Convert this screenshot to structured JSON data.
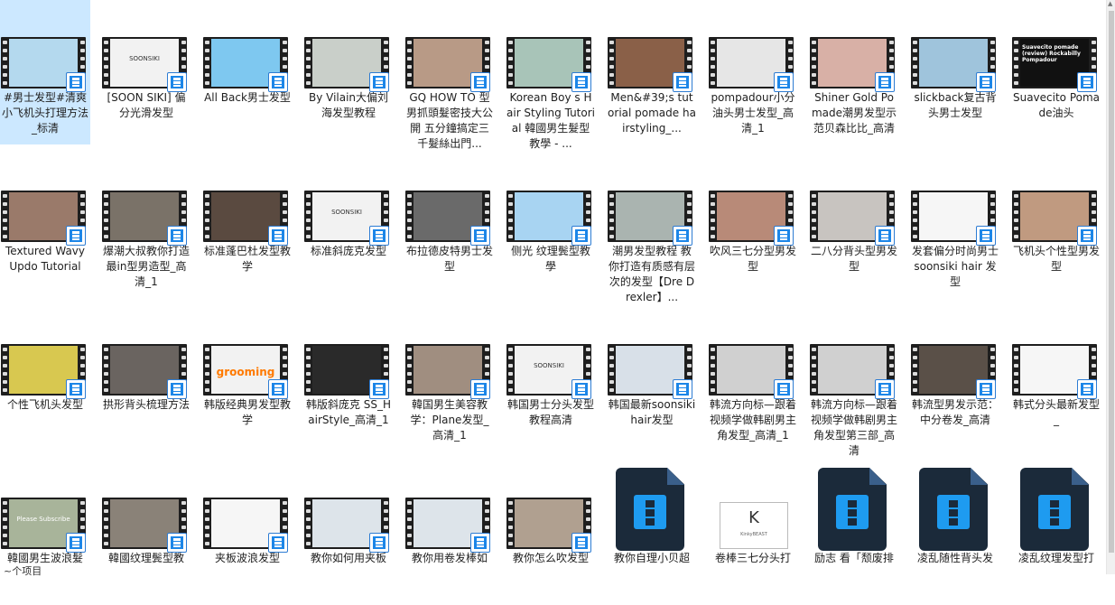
{
  "status_text": "~个项目",
  "files": [
    {
      "label": "#男士发型#清爽小飞机头打理方法_标清",
      "thumb": "#b4d9ee",
      "selected": true,
      "mark": "",
      "markType": "text"
    },
    {
      "label": "[SOON SIKI] 偏分光滑发型",
      "thumb": "#f2f2f2",
      "mark": "SOONSIKI",
      "markType": "text"
    },
    {
      "label": "All Back男士发型",
      "thumb": "#7ec8f0",
      "mark": "",
      "markType": "text"
    },
    {
      "label": "By Vilain大偏刘海发型教程",
      "thumb": "#c9cfc9",
      "mark": "",
      "markType": "text"
    },
    {
      "label": "GQ HOW TO 型男抓頭髮密技大公開 五分鐘搞定三千髮絲出門...",
      "thumb": "#b89a86",
      "mark": "",
      "markType": "text"
    },
    {
      "label": "Korean Boy s Hair Styling Tutorial 韓國男生髮型教學 - ...",
      "thumb": "#a8c4b8",
      "mark": "",
      "markType": "text"
    },
    {
      "label": "Men&#39;s tutorial pomade hairstyling_...",
      "thumb": "#8a6048",
      "mark": "",
      "markType": "text"
    },
    {
      "label": "pompadour小分油头男士发型_高清_1",
      "thumb": "#e6e6e6",
      "mark": "",
      "markType": "text"
    },
    {
      "label": "Shiner Gold Pomade潮男发型示范贝森比比_高清",
      "thumb": "#d8b0a6",
      "mark": "",
      "markType": "text"
    },
    {
      "label": "slickback复古背头男士发型",
      "thumb": "#9fc4dc",
      "mark": "",
      "markType": "text"
    },
    {
      "label": "Suavecito Pomade油头",
      "thumb": "#111111",
      "mark": "Suavecito pomade (review) Rockabilly Pompadour",
      "markType": "dark"
    },
    {
      "label": "Textured Wavy Updo Tutorial",
      "thumb": "#9a7a6a",
      "mark": "",
      "markType": "text"
    },
    {
      "label": "爆潮大叔教你打造最in型男造型_高清_1",
      "thumb": "#7a7268",
      "mark": "",
      "markType": "text"
    },
    {
      "label": "标准蓬巴杜发型教学",
      "thumb": "#5a4a40",
      "mark": "",
      "markType": "text"
    },
    {
      "label": "标准斜庞克发型",
      "thumb": "#f2f2f2",
      "mark": "SOONSIKI",
      "markType": "text"
    },
    {
      "label": "布拉德皮特男士发型",
      "thumb": "#6a6a6a",
      "mark": "",
      "markType": "text"
    },
    {
      "label": "侧光 纹理鬓型教學",
      "thumb": "#a8d4f2",
      "mark": "",
      "markType": "text"
    },
    {
      "label": "潮男发型教程 教你打造有质感有层次的发型【Dre Drexler】...",
      "thumb": "#aab4b0",
      "mark": "",
      "markType": "text"
    },
    {
      "label": "吹风三七分型男发型",
      "thumb": "#b88a78",
      "mark": "",
      "markType": "text"
    },
    {
      "label": "二八分背头型男发型",
      "thumb": "#c8c4c0",
      "mark": "",
      "markType": "text"
    },
    {
      "label": "发套偏分时尚男士 soonsiki hair 发型",
      "thumb": "#f6f6f6",
      "mark": "",
      "markType": "text"
    },
    {
      "label": "飞机头个性型男发型",
      "thumb": "#c09a80",
      "mark": "",
      "markType": "text"
    },
    {
      "label": "个性飞机头发型",
      "thumb": "#d8c850",
      "mark": "",
      "markType": "text"
    },
    {
      "label": "拱形背头梳理方法",
      "thumb": "#6a6460",
      "mark": "",
      "markType": "text"
    },
    {
      "label": "韩版经典男发型教学",
      "thumb": "#f2f2f2",
      "mark": "grooming",
      "markType": "brand"
    },
    {
      "label": "韩版斜庞克 SS_HairStyle_高清_1",
      "thumb": "#2a2a2a",
      "mark": "",
      "markType": "text"
    },
    {
      "label": "韓国男生美容教学：Plane发型_高清_1",
      "thumb": "#a08e80",
      "mark": "",
      "markType": "text"
    },
    {
      "label": "韩国男士分头发型教程高清",
      "thumb": "#f2f2f2",
      "mark": "SOONSIKI",
      "markType": "text"
    },
    {
      "label": "韩国最新soonsiki hair发型",
      "thumb": "#d8e0e8",
      "mark": "",
      "markType": "text"
    },
    {
      "label": "韩流方向标—跟着视频学做韩剧男主角发型_高清_1",
      "thumb": "#d0d0d0",
      "mark": "",
      "markType": "text"
    },
    {
      "label": "韩流方向标—跟着视频学做韩剧男主角发型第三部_高清",
      "thumb": "#d0d0d0",
      "mark": "",
      "markType": "text"
    },
    {
      "label": "韩流型男发示范：中分卷发_高清",
      "thumb": "#5a5048",
      "mark": "",
      "markType": "text"
    },
    {
      "label": "韩式分头最新发型_",
      "thumb": "#f6f6f6",
      "mark": "",
      "markType": "text"
    },
    {
      "label": "韓國男生波浪髮",
      "thumb": "#a8b49a",
      "mark": "Please Subscribe",
      "markType": "light"
    },
    {
      "label": "韓國纹理鬓型教",
      "thumb": "#8a8278",
      "mark": "",
      "markType": "text"
    },
    {
      "label": "夹板波浪发型",
      "thumb": "#f6f6f6",
      "mark": "",
      "markType": "text"
    },
    {
      "label": "教你如何用夹板",
      "thumb": "#dde4ea",
      "mark": "",
      "markType": "text"
    },
    {
      "label": "教你用卷发棒如",
      "thumb": "#dde4ea",
      "mark": "",
      "markType": "text"
    },
    {
      "label": "教你怎么吹发型",
      "thumb": "#b0a090",
      "mark": "",
      "markType": "text"
    },
    {
      "label": "教你自理小贝超",
      "icon": "file"
    },
    {
      "label": "卷棒三七分头打",
      "icon": "logo",
      "mark": "KinkyBEAST"
    },
    {
      "label": "励志 看「颓废排",
      "icon": "file"
    },
    {
      "label": "凌乱随性背头发",
      "icon": "file"
    },
    {
      "label": "凌乱纹理发型打",
      "icon": "file"
    }
  ]
}
